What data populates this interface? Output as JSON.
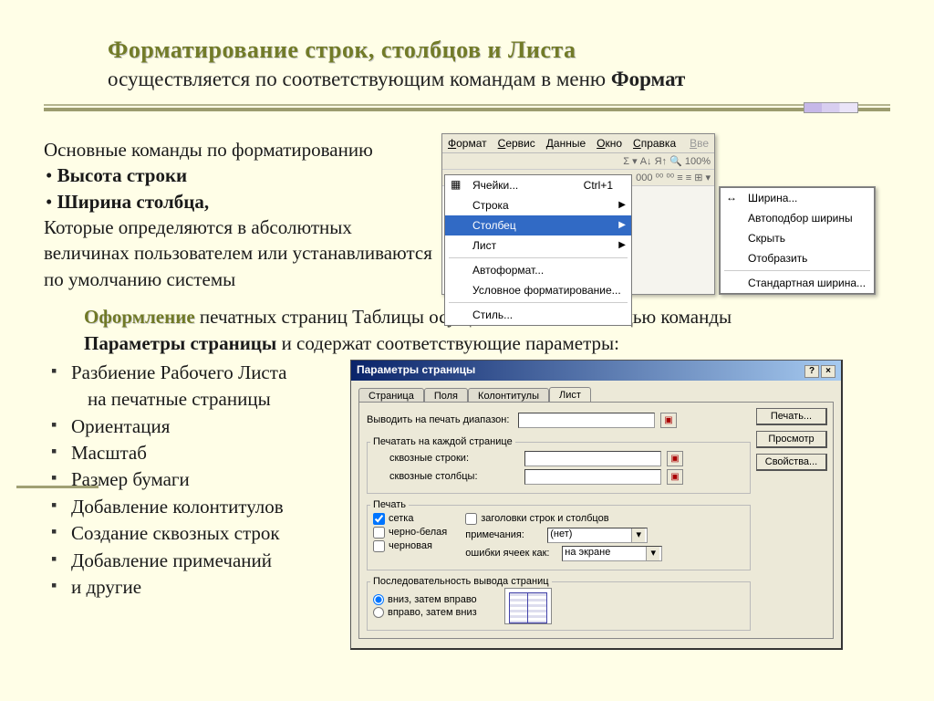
{
  "title": {
    "line1": "Форматирование строк, столбцов и Листа",
    "line2_a": "осуществляется   по соответствующим  командам в меню ",
    "line2_b": "Формат"
  },
  "block1": {
    "l1": "Основные команды по форматированию",
    "b1": "Высота строки",
    "b2": "Ширина столбца,",
    "l2": "Которые определяются в абсолютных величинах пользователем или устанавливаются по умолчанию системы"
  },
  "menubar": {
    "i0": "Формат",
    "i1": "Сервис",
    "i2": "Данные",
    "i3": "Окно",
    "i4": "Справка",
    "extra": "Вве"
  },
  "toolbar": {
    "r1": "Σ  ▾  A↓  Я↑  🔍  100%",
    "r2": "000  ⁰⁰  ⁰⁰   ≡  ≡   ⊞  ▾"
  },
  "menu1": {
    "cells": "Ячейки...",
    "cells_sc": "Ctrl+1",
    "row": "Строка",
    "col": "Столбец",
    "sheet": "Лист",
    "autofmt": "Автоформат...",
    "condfmt": "Условное форматирование...",
    "style": "Стиль..."
  },
  "menu2": {
    "width": "Ширина...",
    "autofit": "Автоподбор ширины",
    "hide": "Скрыть",
    "unhide": "Отобразить",
    "std": "Стандартная ширина..."
  },
  "section2": {
    "oform": "Оформление",
    "txt1": "  печатных страниц Таблицы осуществляется с помощью команды",
    "param": "Параметры страницы",
    "txt2": " и содержат соответствующие параметры:"
  },
  "list": {
    "i0": "Разбиение Рабочего Листа",
    "i0b": "на печатные страницы",
    "i1": "Ориентация",
    "i2": "Масштаб",
    "i3": "Размер бумаги",
    "i4": "Добавление колонтитулов",
    "i5": "Создание сквозных строк",
    "i6": "Добавление примечаний",
    "i7": "и другие"
  },
  "dialog": {
    "title": "Параметры страницы",
    "tabs": {
      "t0": "Страница",
      "t1": "Поля",
      "t2": "Колонтитулы",
      "t3": "Лист"
    },
    "btns": {
      "print": "Печать...",
      "preview": "Просмотр",
      "props": "Свойства..."
    },
    "f_range": "Выводить на печать диапазон:",
    "grp_each": "Печатать на каждой странице",
    "f_rows": "сквозные строки:",
    "f_cols": "сквозные столбцы:",
    "grp_print": "Печать",
    "c_grid": "сетка",
    "c_bw": "черно-белая",
    "c_draft": "черновая",
    "c_head": "заголовки строк и столбцов",
    "l_notes": "примечания:",
    "v_notes": "(нет)",
    "l_err": "ошибки ячеек как:",
    "v_err": "на экране",
    "grp_order": "Последовательность вывода страниц",
    "r_down": "вниз, затем вправо",
    "r_right": "вправо, затем вниз"
  }
}
